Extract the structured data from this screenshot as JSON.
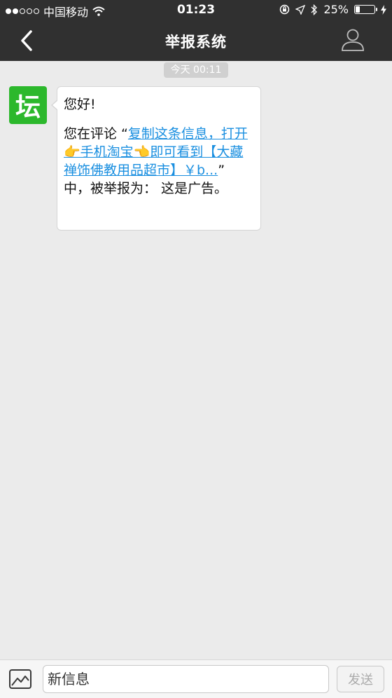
{
  "status_bar": {
    "carrier": "中国移动",
    "time": "01:23",
    "battery": "25%",
    "battery_level": 0.25
  },
  "header": {
    "title": "举报系统"
  },
  "chat": {
    "timestamp": "今天 00:11",
    "avatar_text": "坛",
    "message": {
      "greeting": "您好!",
      "prefix": "您在评论 “",
      "link_text": "复制这条信息，打开👉手机淘宝👈即可看到【大藏禅饰佛教用品超市】￥b...",
      "suffix": "” 中，被举报为：  这是广告。"
    }
  },
  "input_bar": {
    "placeholder": "新信息",
    "send_label": "发送"
  },
  "colors": {
    "header_bg": "#303030",
    "chat_bg": "#ebebeb",
    "link": "#1a8fe0",
    "avatar_bg": "#2cb82c"
  }
}
